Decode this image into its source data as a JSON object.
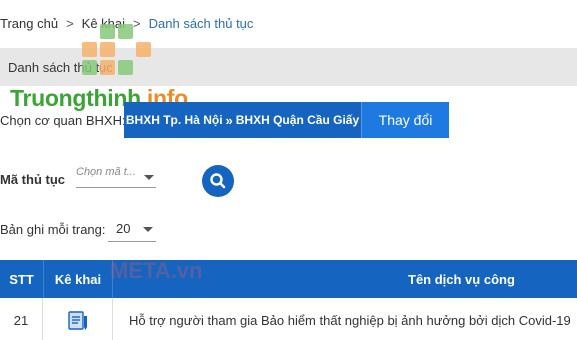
{
  "breadcrumb": {
    "items": [
      "Trang chủ",
      "Kê khai",
      "Danh sách thủ tục"
    ],
    "separator": ">"
  },
  "section": {
    "title": "Danh sách thủ tục"
  },
  "logo": {
    "part1": "Truongthinh",
    "part2": ".info",
    "green": "#3aa535",
    "orange": "#f08a24"
  },
  "agency": {
    "label": "Chọn cơ quan BHXH:",
    "level1": "BHXH Tp. Hà Nội",
    "separator": "»",
    "level2": "BHXH Quận Cầu Giấy",
    "change_label": "Thay đổi"
  },
  "filter": {
    "procedure_label": "Mã thủ tục",
    "procedure_placeholder": "Chọn mã t...",
    "search_icon": "search-icon"
  },
  "paging": {
    "rows_label": "Bản ghi mỗi trang:",
    "rows_value": "20"
  },
  "table": {
    "columns": [
      "STT",
      "Kê khai",
      "Tên dịch vụ công"
    ],
    "rows": [
      {
        "stt": "21",
        "declare_icon": "form-document-icon",
        "name": "Hỗ trợ người tham gia Bảo hiểm thất nghiệp bị ảnh hưởng bởi dịch Covid-19"
      }
    ]
  },
  "watermark": "META.vn",
  "colors": {
    "primary": "#1565c0",
    "button": "#1e7ae0",
    "link": "#2a6fb5",
    "section_bg": "#e7e7e7"
  }
}
